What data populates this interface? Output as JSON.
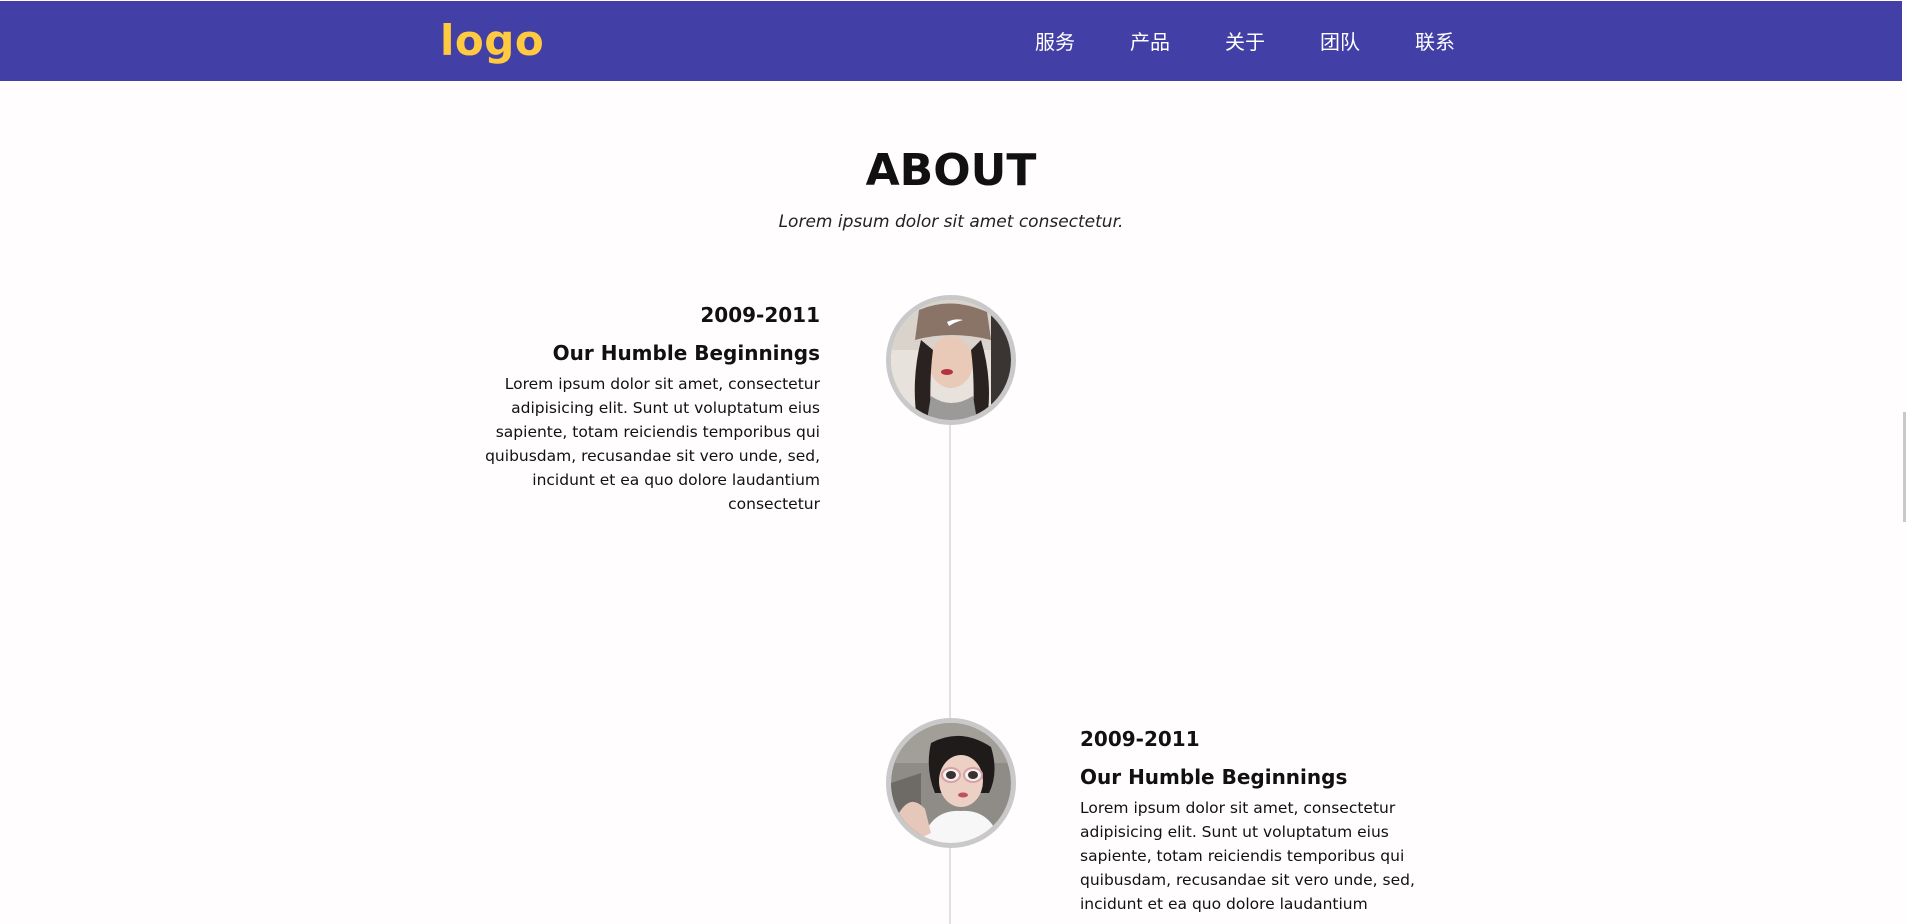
{
  "navbar": {
    "logo": "logo",
    "links": [
      "服务",
      "产品",
      "关于",
      "团队",
      "联系"
    ],
    "colors": {
      "background": "#4240a6",
      "logo": "#ffc940",
      "link": "#ffffff"
    }
  },
  "about": {
    "title": "ABOUT",
    "subtitle": "Lorem ipsum dolor sit amet consectetur.",
    "timeline": [
      {
        "date": "2009-2011",
        "heading": "Our Humble Beginnings",
        "body": "Lorem ipsum dolor sit amet, consectetur adipisicing elit. Sunt ut voluptatum eius sapiente, totam reiciendis temporibus qui quibusdam, recusandae sit vero unde, sed, incidunt et ea quo dolore laudantium consectetur",
        "avatar": "portrait-photo-cap"
      },
      {
        "date": "2009-2011",
        "heading": "Our Humble Beginnings",
        "body": "Lorem ipsum dolor sit amet, consectetur adipisicing elit. Sunt ut voluptatum eius sapiente, totam reiciendis temporibus qui quibusdam, recusandae sit vero unde, sed, incidunt et ea quo dolore laudantium",
        "avatar": "portrait-photo-sunglasses"
      }
    ]
  }
}
